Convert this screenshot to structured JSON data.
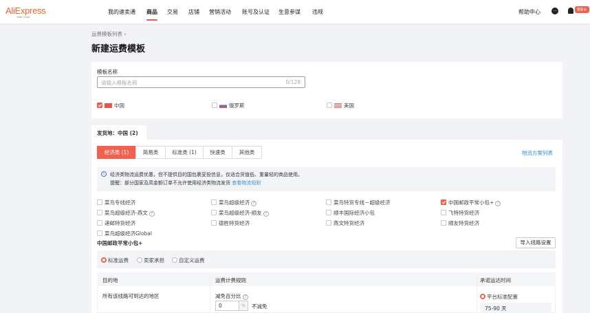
{
  "header": {
    "logo": "AliExpress",
    "logo_sub": "Seller Center",
    "nav": [
      "我的速卖通",
      "商品",
      "交易",
      "店铺",
      "营销活动",
      "账号及认证",
      "生意参谋",
      "违规"
    ],
    "active_nav": 1,
    "help": "帮助中心",
    "badge": "99+"
  },
  "breadcrumb": "运费模板列表",
  "page_title": "新建运费模板",
  "form": {
    "name_label": "模板名称",
    "name_placeholder": "请输入模板名称",
    "name_count": "0/128",
    "countries": [
      {
        "label": "中国",
        "checked": true
      },
      {
        "label": "俄罗斯",
        "checked": false
      },
      {
        "label": "美国",
        "checked": false
      }
    ]
  },
  "origin_tab": "发货地：中国 (2)",
  "method_tabs": [
    "经济类 (1)",
    "简易类",
    "标准类 (1)",
    "快速类",
    "其他类"
  ],
  "scheme_link": "物流方案列表",
  "notice": {
    "line1": "经济类物流运费优惠，但不提供目的国包裹妥投信息，仅适合货值低、重量轻的商品使用。",
    "line2": "提醒：部分国家及高金额订单不允许使用经济类物流发货",
    "link": "查看物流规则"
  },
  "carriers": [
    {
      "label": "菜鸟专线经济",
      "checked": false,
      "help": false
    },
    {
      "label": "菜鸟超级经济",
      "checked": false,
      "help": true
    },
    {
      "label": "菜鸟特货专线－超级经济",
      "checked": false,
      "help": false
    },
    {
      "label": "中国邮政平常小包+",
      "checked": true,
      "help": true
    },
    {
      "label": "菜鸟超级经济-燕文",
      "checked": false,
      "help": true
    },
    {
      "label": "菜鸟超级经济-顺友",
      "checked": false,
      "help": true
    },
    {
      "label": "顺丰国际经济小包",
      "checked": false,
      "help": false
    },
    {
      "label": "飞特特货经济",
      "checked": false,
      "help": false
    },
    {
      "label": "递邮特货经济",
      "checked": false,
      "help": false
    },
    {
      "label": "德胜特货经济",
      "checked": false,
      "help": false
    },
    {
      "label": "燕文特货经济",
      "checked": false,
      "help": false
    },
    {
      "label": "顺友特货经济",
      "checked": false,
      "help": false
    },
    {
      "label": "菜鸟超级经济Global",
      "checked": false,
      "help": false
    }
  ],
  "section": {
    "title": "中国邮政平常小包+",
    "import_btn": "导入线路设置",
    "fee_options": [
      "标准运费",
      "卖家承担",
      "自定义运费"
    ],
    "table": {
      "headers": [
        "目的地",
        "运费计费规则",
        "承诺运达时间"
      ],
      "row": {
        "dest": "所有该线路可到达的地区",
        "discount_label": "减免百分比",
        "discount_value": "0",
        "unit": "%",
        "no_discount": "不减免",
        "time_option": "平台标准配置",
        "time_value": "75-90 天"
      }
    }
  }
}
